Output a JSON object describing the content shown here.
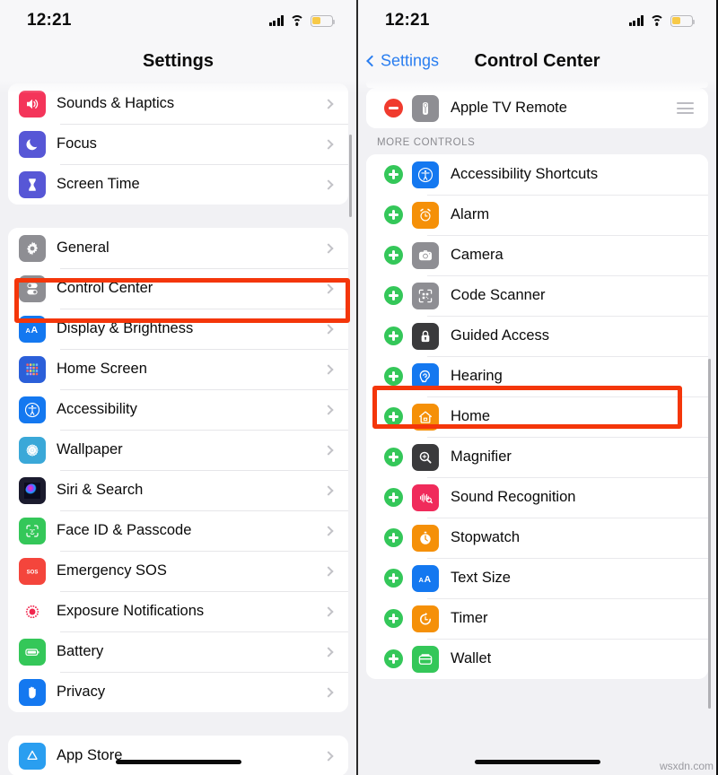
{
  "status_bar": {
    "time": "12:21",
    "signal_icon": "cellular-signal-icon",
    "wifi_icon": "wifi-icon",
    "battery_icon": "battery-icon",
    "battery_color": "#f7c948",
    "battery_level_percent": 45
  },
  "colors": {
    "highlight": "#f4360a",
    "accent_blue": "#2a7ef0",
    "add_green": "#34c759",
    "remove_red": "#f03b2e",
    "page_background": "#f1f1f4"
  },
  "left_panel": {
    "nav": {
      "title": "Settings"
    },
    "groups": [
      {
        "rows": [
          {
            "label": "Sounds & Haptics",
            "icon": "speaker-icon",
            "icon_color": "#f4355a"
          },
          {
            "label": "Focus",
            "icon": "moon-icon",
            "icon_color": "#5757d6"
          },
          {
            "label": "Screen Time",
            "icon": "hourglass-icon",
            "icon_color": "#5757d6"
          }
        ]
      },
      {
        "rows": [
          {
            "label": "General",
            "icon": "gear-icon",
            "icon_color": "#8e8e93"
          },
          {
            "label": "Control Center",
            "icon": "control-center-icon",
            "icon_color": "#8e8e93",
            "highlighted": true
          },
          {
            "label": "Display & Brightness",
            "icon": "text-size-aa-icon",
            "icon_color": "#1478f0"
          },
          {
            "label": "Home Screen",
            "icon": "home-screen-grid-icon",
            "icon_color": "#2b5fd9"
          },
          {
            "label": "Accessibility",
            "icon": "accessibility-person-icon",
            "icon_color": "#1478f0"
          },
          {
            "label": "Wallpaper",
            "icon": "wallpaper-flower-icon",
            "icon_color": "#3aa8d8"
          },
          {
            "label": "Siri & Search",
            "icon": "siri-orb-icon",
            "icon_color": "#1b1b2e"
          },
          {
            "label": "Face ID & Passcode",
            "icon": "face-id-icon",
            "icon_color": "#34c759"
          },
          {
            "label": "Emergency SOS",
            "icon": "sos-icon",
            "icon_color": "#f4453c"
          },
          {
            "label": "Exposure Notifications",
            "icon": "exposure-notifications-icon",
            "icon_color": "#ffffff"
          },
          {
            "label": "Battery",
            "icon": "battery-icon",
            "icon_color": "#34c759"
          },
          {
            "label": "Privacy",
            "icon": "privacy-hand-icon",
            "icon_color": "#1478f0"
          }
        ]
      },
      {
        "rows": [
          {
            "label": "App Store",
            "icon": "app-store-icon",
            "icon_color": "#2a9ef0"
          }
        ]
      }
    ]
  },
  "right_panel": {
    "nav": {
      "back_label": "Settings",
      "title": "Control Center"
    },
    "included_rows": [
      {
        "label": "Apple TV Remote",
        "icon": "apple-tv-remote-icon",
        "icon_color": "#8e8e93",
        "action": "remove"
      }
    ],
    "section_header": "MORE CONTROLS",
    "more_controls": [
      {
        "label": "Accessibility Shortcuts",
        "icon": "accessibility-person-icon",
        "icon_color": "#1478f0"
      },
      {
        "label": "Alarm",
        "icon": "alarm-clock-icon",
        "icon_color": "#f59008"
      },
      {
        "label": "Camera",
        "icon": "camera-icon",
        "icon_color": "#8e8e93"
      },
      {
        "label": "Code Scanner",
        "icon": "qr-code-scanner-icon",
        "icon_color": "#8e8e93"
      },
      {
        "label": "Guided Access",
        "icon": "lock-icon",
        "icon_color": "#3a3a3c"
      },
      {
        "label": "Hearing",
        "icon": "ear-icon",
        "icon_color": "#1478f0",
        "highlighted": true
      },
      {
        "label": "Home",
        "icon": "home-house-icon",
        "icon_color": "#f59008"
      },
      {
        "label": "Magnifier",
        "icon": "magnifier-icon",
        "icon_color": "#3a3a3c"
      },
      {
        "label": "Sound Recognition",
        "icon": "sound-recognition-icon",
        "icon_color": "#f02b5b"
      },
      {
        "label": "Stopwatch",
        "icon": "stopwatch-icon",
        "icon_color": "#f59008"
      },
      {
        "label": "Text Size",
        "icon": "text-size-aa-icon",
        "icon_color": "#1478f0"
      },
      {
        "label": "Timer",
        "icon": "timer-icon",
        "icon_color": "#f59008"
      },
      {
        "label": "Wallet",
        "icon": "wallet-icon",
        "icon_color": "#34c759"
      }
    ]
  },
  "watermark": "wsxdn.com"
}
